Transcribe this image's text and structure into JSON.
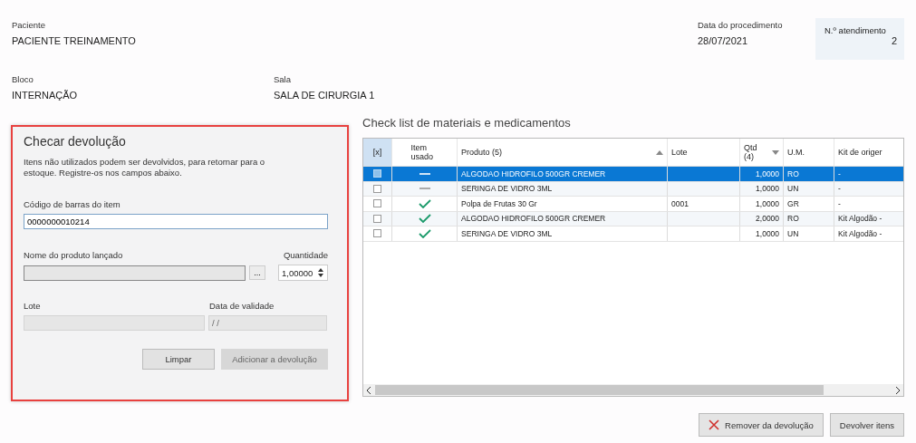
{
  "header": {
    "patient": {
      "label": "Paciente",
      "value": "PACIENTE TREINAMENTO"
    },
    "procedure_date": {
      "label": "Data do procedimento",
      "value": "28/07/2021"
    },
    "attendance": {
      "label": "N.º atendimento",
      "value": "2"
    },
    "block": {
      "label": "Bloco",
      "value": "INTERNAÇÃO"
    },
    "room": {
      "label": "Sala",
      "value": "SALA DE CIRURGIA 1"
    }
  },
  "return_panel": {
    "title": "Checar devolução",
    "description": "Itens não utilizados podem ser devolvidos, para retornar para o estoque. Registre-os nos campos abaixo.",
    "barcode": {
      "label": "Código de barras do item",
      "value": "0000000010214"
    },
    "product_name": {
      "label": "Nome do produto lançado",
      "browse": "..."
    },
    "quantity": {
      "label": "Quantidade",
      "value": "1,00000"
    },
    "batch": {
      "label": "Lote"
    },
    "expiry": {
      "label": "Data de validade",
      "value": "/ /"
    },
    "buttons": [
      {
        "label": "Limpar",
        "disabled": false
      },
      {
        "label": "Adicionar a devolução",
        "disabled": true
      }
    ]
  },
  "checklist": {
    "title": "Check list de materiais e medicamentos",
    "columns": [
      {
        "label": "[x]",
        "kind": "plain"
      },
      {
        "label": "Item usado",
        "kind": "plain"
      },
      {
        "label": "Produto (5)",
        "kind": "ascending"
      },
      {
        "label": "Lote",
        "kind": "plain"
      },
      {
        "label": "Qtd (4)",
        "kind": "descending"
      },
      {
        "label": "U.M.",
        "kind": "plain"
      },
      {
        "label": "Kit de origer",
        "kind": "plain"
      }
    ],
    "rows": [
      {
        "selected": true,
        "checked": false,
        "used": false,
        "product": "ALGODAO HIDROFILO 500GR CREMER",
        "batch": "",
        "qty": "1,0000",
        "unit": "RO",
        "kit": "-"
      },
      {
        "selected": false,
        "checked": false,
        "used": false,
        "product": "SERINGA DE VIDRO 3ML",
        "batch": "",
        "qty": "1,0000",
        "unit": "UN",
        "kit": "-"
      },
      {
        "selected": false,
        "checked": false,
        "used": true,
        "product": "Polpa de Frutas 30 Gr",
        "batch": "0001",
        "qty": "1,0000",
        "unit": "GR",
        "kit": "-"
      },
      {
        "selected": false,
        "checked": false,
        "used": true,
        "product": "ALGODAO HIDROFILO 500GR CREMER",
        "batch": "",
        "qty": "2,0000",
        "unit": "RO",
        "kit": "Kit Algodão -"
      },
      {
        "selected": false,
        "checked": false,
        "used": true,
        "product": "SERINGA DE VIDRO 3ML",
        "batch": "",
        "qty": "1,0000",
        "unit": "UN",
        "kit": "Kit Algodão -"
      }
    ],
    "buttons": [
      {
        "label": "Remover da devolução",
        "kind": "remove"
      },
      {
        "label": "Devolver itens",
        "kind": "plain"
      }
    ]
  }
}
